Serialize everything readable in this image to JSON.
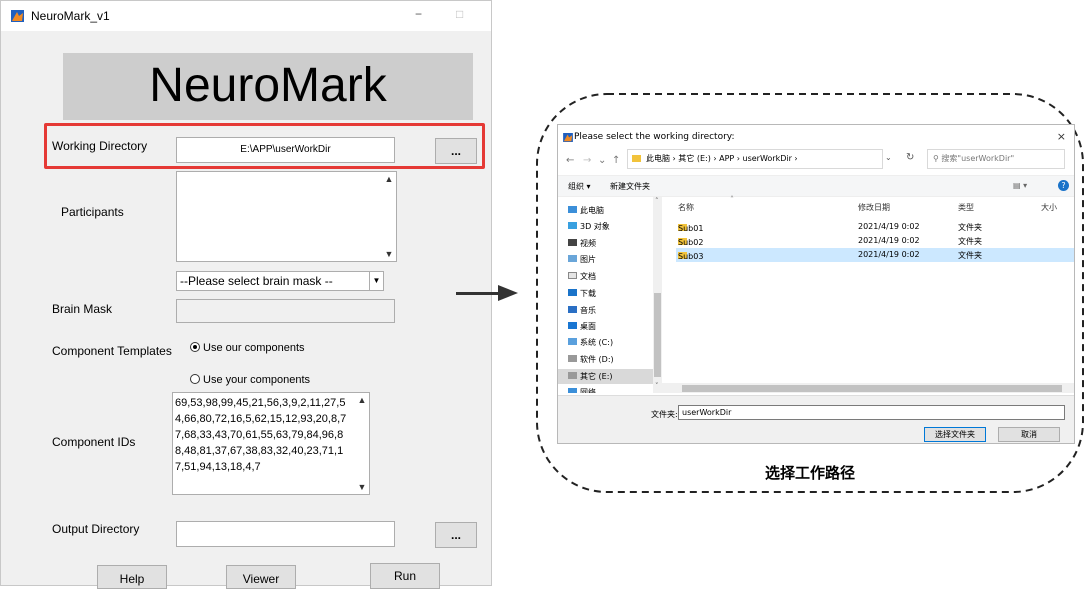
{
  "app": {
    "title": "NeuroMark_v1",
    "banner": "NeuroMark",
    "minimize": "−",
    "maximize": "□",
    "working_directory": {
      "label": "Working Directory",
      "value": "E:\\APP\\userWorkDir",
      "browse": "..."
    },
    "participants": {
      "label": "Participants",
      "value": ""
    },
    "brain_mask": {
      "label": "Brain Mask",
      "select_value": "--Please select brain mask --",
      "value": ""
    },
    "component_templates": {
      "label": "Component Templates",
      "option_ours": "Use our components",
      "option_yours": "Use your components",
      "selected": "ours"
    },
    "component_ids": {
      "label": "Component IDs",
      "value": "69,53,98,99,45,21,56,3,9,2,11,27,54,66,80,72,16,5,62,15,12,93,20,8,77,68,33,43,70,61,55,63,79,84,96,88,48,81,37,67,38,83,32,40,23,71,17,51,94,13,18,4,7"
    },
    "output_directory": {
      "label": "Output Directory",
      "value": "",
      "browse": "..."
    },
    "buttons": {
      "help": "Help",
      "viewer": "Viewer",
      "run": "Run"
    }
  },
  "dialog": {
    "title": "Please select the working directory:",
    "close": "×",
    "breadcrumb": "此电脑  ›  其它 (E:)  ›  APP  ›  userWorkDir  ›",
    "search_placeholder": "搜索\"userWorkDir\"",
    "toolbar": {
      "organize": "组织 ▾",
      "new_folder": "新建文件夹",
      "view": "▤ ▾",
      "help": "?"
    },
    "columns": {
      "name": "名称",
      "date": "修改日期",
      "type": "类型",
      "size": "大小"
    },
    "nav": [
      "此电脑",
      "3D 对象",
      "视频",
      "图片",
      "文档",
      "下载",
      "音乐",
      "桌面",
      "系统 (C:)",
      "软件 (D:)",
      "其它 (E:)",
      "网络"
    ],
    "files": [
      {
        "name": "Sub01",
        "date": "2021/4/19 0:02",
        "type": "文件夹"
      },
      {
        "name": "Sub02",
        "date": "2021/4/19 0:02",
        "type": "文件夹"
      },
      {
        "name": "Sub03",
        "date": "2021/4/19 0:02",
        "type": "文件夹"
      }
    ],
    "folder_label": "文件夹:",
    "folder_value": "userWorkDir",
    "select_button": "选择文件夹",
    "cancel_button": "取消"
  },
  "caption": "选择工作路径",
  "colors": {
    "highlight": "#e53935",
    "selected_row": "#cce8ff",
    "folder": "#f2c33b"
  }
}
